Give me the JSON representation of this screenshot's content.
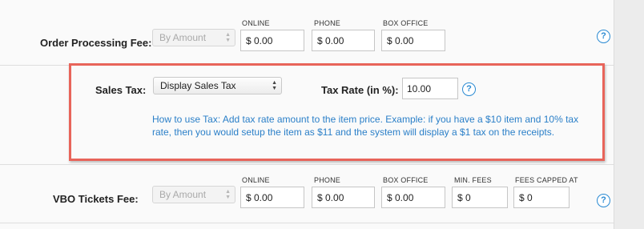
{
  "order_processing_fee": {
    "label": "Order Processing Fee:",
    "type_select": "By Amount",
    "fields": [
      {
        "label": "ONLINE",
        "value": "$ 0.00"
      },
      {
        "label": "PHONE",
        "value": "$ 0.00"
      },
      {
        "label": "BOX OFFICE",
        "value": "$ 0.00"
      }
    ],
    "help": "?"
  },
  "sales_tax": {
    "label": "Sales Tax:",
    "select_value": "Display Sales Tax",
    "tax_rate_label": "Tax Rate (in %):",
    "tax_rate_value": "10.00",
    "help": "?",
    "howto_title": "How to use Tax",
    "howto_text": ": Add tax rate amount to the item price. Example: if you have a $10 item and 10% tax rate, then you would setup the item as $11 and the system will display a $1 tax on the receipts.",
    "highlight_color": "#e8645a"
  },
  "vbo_tickets_fee": {
    "label": "VBO Tickets Fee:",
    "type_select": "By Amount",
    "fields": [
      {
        "label": "ONLINE",
        "value": "$ 0.00"
      },
      {
        "label": "PHONE",
        "value": "$ 0.00"
      },
      {
        "label": "BOX OFFICE",
        "value": "$ 0.00"
      },
      {
        "label": "MIN. FEES",
        "value": "$ 0"
      },
      {
        "label": "FEES CAPPED AT",
        "value": "$ 0"
      }
    ],
    "help": "?"
  },
  "colors": {
    "link_blue": "#2a7fc8",
    "icon_blue": "#2a8ad2"
  }
}
